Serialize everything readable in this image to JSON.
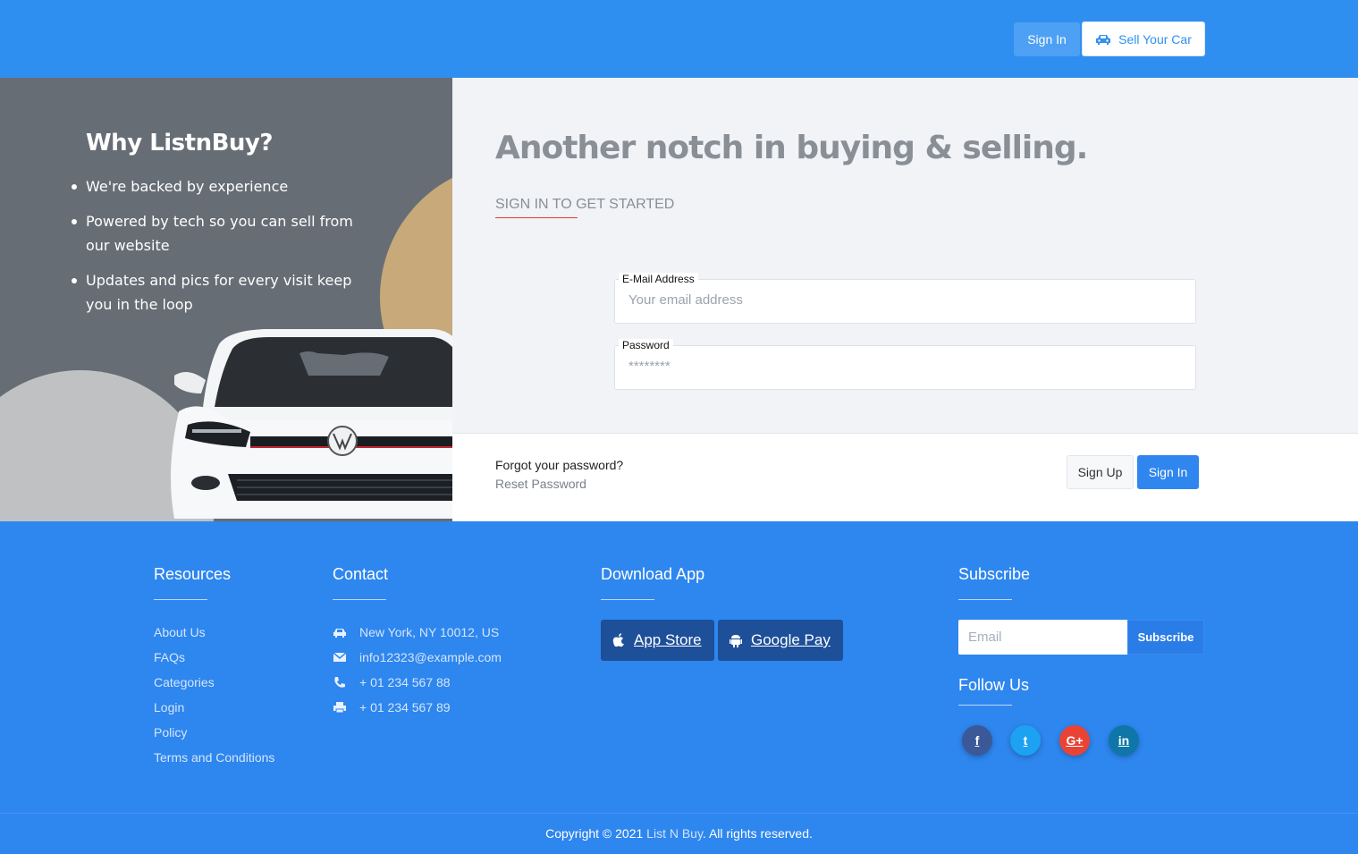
{
  "header": {
    "signin_label": "Sign In",
    "sell_label": "Sell Your Car",
    "sell_icon": "car-icon"
  },
  "promo": {
    "title": "Why ListnBuy?",
    "points": [
      "We're backed by experience",
      "Powered by tech so you can sell from our website",
      "Updates and pics for every visit keep you in the loop"
    ],
    "colors": {
      "panel": "#666d75",
      "gold_circle": "#c7a97a",
      "gray_circle": "#bfc1c3"
    }
  },
  "form": {
    "headline": "Another notch in buying & selling.",
    "subhead": "SIGN IN TO GET STARTED",
    "email": {
      "label": "E-Mail Address",
      "placeholder": "Your email address",
      "value": ""
    },
    "password": {
      "label": "Password",
      "placeholder": "********",
      "value": ""
    },
    "forgot_text": "Forgot your password?",
    "reset_link": "Reset Password",
    "signup_label": "Sign Up",
    "signin_label": "Sign In"
  },
  "footer": {
    "resources": {
      "title": "Resources",
      "links": [
        "About Us",
        "FAQs",
        "Categories",
        "Login",
        "Policy",
        "Terms and Conditions"
      ]
    },
    "contact": {
      "title": "Contact",
      "items": [
        {
          "icon": "car-icon",
          "text": "New York, NY 10012, US"
        },
        {
          "icon": "envelope-icon",
          "text": "info12323@example.com"
        },
        {
          "icon": "phone-icon",
          "text": "+ 01 234 567 88"
        },
        {
          "icon": "printer-icon",
          "text": "+ 01 234 567 89"
        }
      ]
    },
    "download": {
      "title": "Download App",
      "app_store": "App Store",
      "google_pay": "Google Pay"
    },
    "subscribe": {
      "title": "Subscribe",
      "placeholder": "Email",
      "button": "Subscribe",
      "follow_title": "Follow Us",
      "social": [
        {
          "name": "facebook",
          "label": "f",
          "color": "#3b5998"
        },
        {
          "name": "twitter",
          "label": "t",
          "color": "#1da1f2"
        },
        {
          "name": "google-plus",
          "label": "G+",
          "color": "#ea4335"
        },
        {
          "name": "linkedin",
          "label": "in",
          "color": "#0e76a8"
        }
      ]
    },
    "copyright_prefix": "Copyright © 2021 ",
    "copyright_brand": "List N Buy",
    "copyright_suffix": ". All rights reserved."
  },
  "colors": {
    "primary": "#2f8ff0",
    "footer": "#2e86ef",
    "store_button": "#1e4f99",
    "accent_underline": "#e03b3b"
  }
}
